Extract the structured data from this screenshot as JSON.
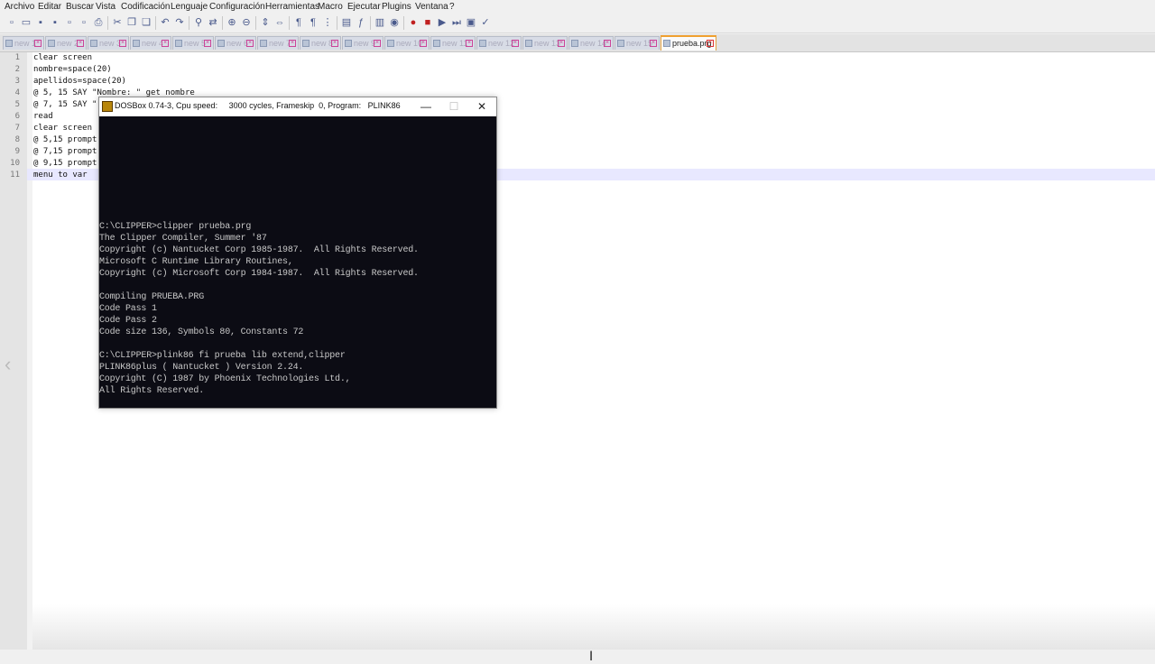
{
  "menu": [
    "Archivo",
    "Editar",
    "Buscar",
    "Vista",
    "Codificación",
    "Lenguaje",
    "Configuración",
    "Herramientas",
    "Macro",
    "Ejecutar",
    "Plugins",
    "Ventana",
    "?"
  ],
  "toolbar_icons": [
    "new-file-icon",
    "open-file-icon",
    "save-icon",
    "save-all-icon",
    "close-icon",
    "close-all-icon",
    "print-icon",
    "cut-icon",
    "copy-icon",
    "paste-icon",
    "undo-icon",
    "redo-icon",
    "find-icon",
    "replace-icon",
    "zoom-in-icon",
    "zoom-out-icon",
    "sync-v-icon",
    "sync-h-icon",
    "wrap-icon",
    "show-all-chars-icon",
    "indent-guide-icon",
    "doc-map-icon",
    "function-list-icon",
    "folder-icon",
    "monitor-icon",
    "record-macro-icon",
    "stop-macro-icon",
    "play-macro-icon",
    "play-multi-icon",
    "save-macro-icon",
    "spellcheck-icon"
  ],
  "tabs": [
    {
      "label": "new 1",
      "active": false
    },
    {
      "label": "new 2",
      "active": false
    },
    {
      "label": "new 3",
      "active": false
    },
    {
      "label": "new 4",
      "active": false
    },
    {
      "label": "new 5",
      "active": false
    },
    {
      "label": "new 6",
      "active": false
    },
    {
      "label": "new 7",
      "active": false
    },
    {
      "label": "new 8",
      "active": false
    },
    {
      "label": "new 9",
      "active": false
    },
    {
      "label": "new 10",
      "active": false
    },
    {
      "label": "new 11",
      "active": false
    },
    {
      "label": "new 12",
      "active": false
    },
    {
      "label": "new 13",
      "active": false
    },
    {
      "label": "new 14",
      "active": false
    },
    {
      "label": "new 15",
      "active": false
    },
    {
      "label": "prueba.prg",
      "active": true
    }
  ],
  "editor": {
    "lines": [
      "clear screen",
      "nombre=space(20)",
      "apellidos=space(20)",
      "@ 5, 15 SAY \"Nombre: \" get nombre",
      "@ 7, 15 SAY \"",
      "read",
      "clear screen",
      "@ 5,15 prompt",
      "@ 7,15 prompt",
      "@ 9,15 prompt",
      "menu to var"
    ],
    "line_numbers": [
      "1",
      "2",
      "3",
      "4",
      "5",
      "6",
      "7",
      "8",
      "9",
      "10",
      "11"
    ]
  },
  "dosbox": {
    "title": "DOSBox 0.74-3, Cpu speed:     3000 cycles, Frameskip  0, Program:   PLINK86",
    "minimize": "—",
    "maximize": "☐",
    "close": "✕",
    "screen_lines": [
      "C:\\CLIPPER>clipper prueba.prg",
      "The Clipper Compiler, Summer '87",
      "Copyright (c) Nantucket Corp 1985-1987.  All Rights Reserved.",
      "Microsoft C Runtime Library Routines,",
      "Copyright (c) Microsoft Corp 1984-1987.  All Rights Reserved.",
      "",
      "Compiling PRUEBA.PRG",
      "Code Pass 1",
      "Code Pass 2",
      "Code size 136, Symbols 80, Constants 72",
      "",
      "C:\\CLIPPER>plink86 fi prueba lib extend,clipper",
      "PLINK86plus ( Nantucket ) Version 2.24.",
      "Copyright (C) 1987 by Phoenix Technologies Ltd.,",
      "All Rights Reserved."
    ]
  },
  "colors": {
    "active_tab_accent": "#f0a030",
    "current_line": "#e8e8ff",
    "dos_bg": "#0c0c14"
  }
}
